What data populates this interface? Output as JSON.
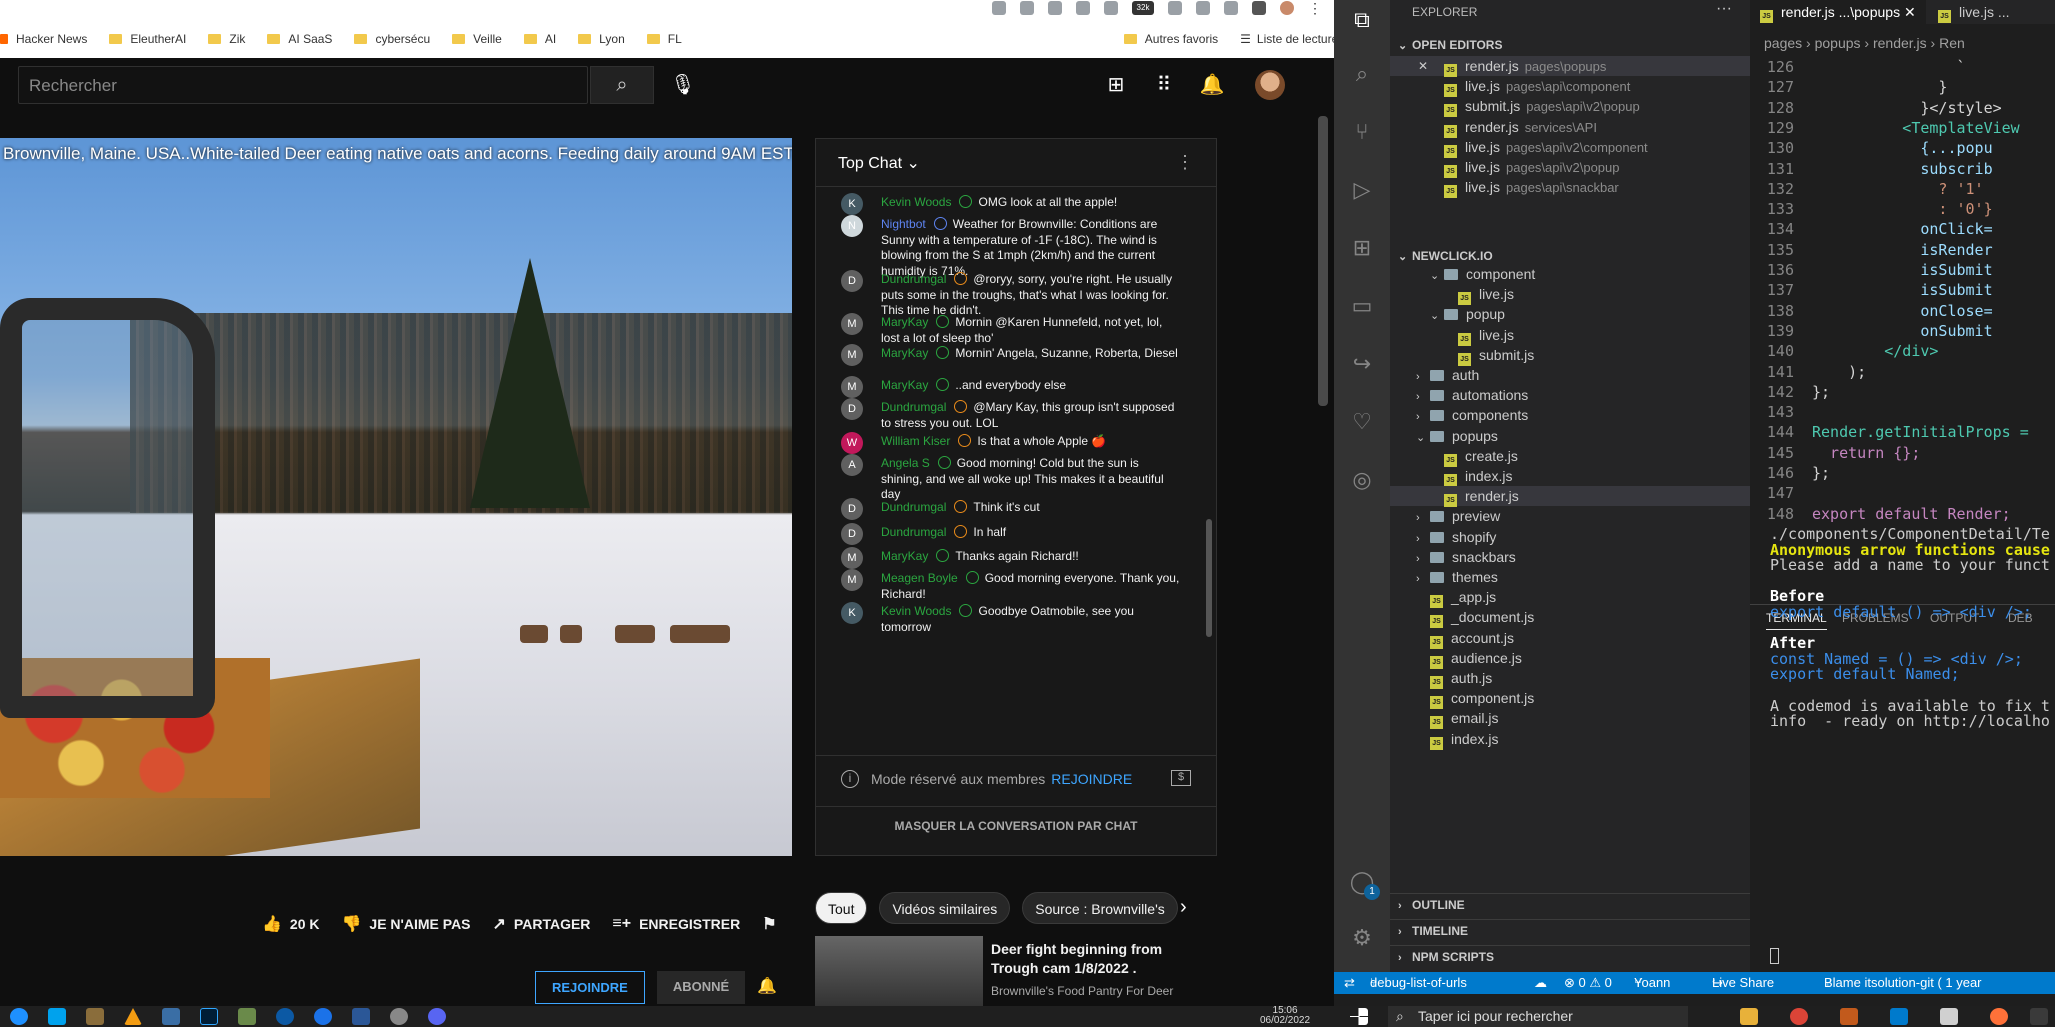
{
  "browser": {
    "bookmarks": [
      "Hacker News",
      "EleutherAI",
      "Zik",
      "AI SaaS",
      "cybersécu",
      "Veille",
      "AI",
      "Lyon",
      "FL"
    ],
    "bookmarks_right": [
      "Autres favoris",
      "Liste de lecture"
    ],
    "ext_badge": "32k"
  },
  "youtube": {
    "search_placeholder": "Rechercher",
    "video_title": "Brownville, Maine. USA..White-tailed Deer eating native oats and acorns. Feeding daily around 9AM EST",
    "chat": {
      "header": "Top Chat",
      "messages": [
        {
          "initial": "K",
          "author": "Kevin Woods",
          "badge": "verified",
          "text": "OMG look at all the apple!"
        },
        {
          "initial": "N",
          "author": "Nightbot",
          "badge": "mod",
          "text": "Weather for Brownville: Conditions are Sunny with a temperature of -1F (-18C). The wind is blowing from the S at 1mph (2km/h) and the current humidity is 71%."
        },
        {
          "initial": "D",
          "author": "Dundrumgal",
          "badge": "member",
          "text": "@roryy, sorry, you're right. He usually puts some in the troughs, that's what I was looking for. This time he didn't."
        },
        {
          "initial": "M",
          "author": "MaryKay",
          "badge": "verified",
          "text": "Mornin @Karen Hunnefeld, not yet, lol, lost a lot of sleep tho'"
        },
        {
          "initial": "M",
          "author": "MaryKay",
          "badge": "verified",
          "text": "Mornin' Angela, Suzanne, Roberta, Diesel"
        },
        {
          "initial": "M",
          "author": "MaryKay",
          "badge": "verified",
          "text": "..and everybody else"
        },
        {
          "initial": "D",
          "author": "Dundrumgal",
          "badge": "member",
          "text": "@Mary Kay, this group isn't supposed to stress you out. LOL"
        },
        {
          "initial": "W",
          "author": "William Kiser",
          "badge": "member",
          "text": "Is that a whole Apple 🍎"
        },
        {
          "initial": "A",
          "author": "Angela S",
          "badge": "verified",
          "text": "Good morning! Cold but the sun is shining, and we all woke up! This makes it a beautiful day"
        },
        {
          "initial": "D",
          "author": "Dundrumgal",
          "badge": "member",
          "text": "Think it's cut"
        },
        {
          "initial": "D",
          "author": "Dundrumgal",
          "badge": "member",
          "text": "In half"
        },
        {
          "initial": "M",
          "author": "MaryKay",
          "badge": "verified",
          "text": "Thanks again Richard!!"
        },
        {
          "initial": "M",
          "author": "Meagen Boyle",
          "badge": "verified",
          "text": "Good morning everyone. Thank you, Richard!"
        },
        {
          "initial": "K",
          "author": "Kevin Woods",
          "badge": "verified",
          "text": "Goodbye Oatmobile, see you tomorrow"
        }
      ],
      "members_only": "Mode réservé aux membres",
      "join_link": "REJOINDRE",
      "hide_chat": "MASQUER LA CONVERSATION PAR CHAT"
    },
    "actions": {
      "likes": "20 K",
      "dislike": "JE N'AIME PAS",
      "share": "PARTAGER",
      "save": "ENREGISTRER"
    },
    "join_button": "REJOINDRE",
    "subscribed_button": "ABONNÉ",
    "chips": [
      "Tout",
      "Vidéos similaires",
      "Source : Brownville's"
    ],
    "related": {
      "title": "Deer fight beginning from Trough cam 1/8/2022 .",
      "channel": "Brownville's Food Pantry For Deer"
    }
  },
  "vscode": {
    "explorer_title": "EXPLORER",
    "open_editors_title": "OPEN EDITORS",
    "open_editors": [
      {
        "name": "render.js",
        "path": "pages\\popups",
        "active": true
      },
      {
        "name": "live.js",
        "path": "pages\\api\\component"
      },
      {
        "name": "submit.js",
        "path": "pages\\api\\v2\\popup"
      },
      {
        "name": "render.js",
        "path": "services\\API"
      },
      {
        "name": "live.js",
        "path": "pages\\api\\v2\\component"
      },
      {
        "name": "live.js",
        "path": "pages\\api\\v2\\popup"
      },
      {
        "name": "live.js",
        "path": "pages\\api\\snackbar"
      }
    ],
    "project_title": "NEWCLICK.IO",
    "tree": [
      {
        "name": "component",
        "type": "dir-open",
        "indent": 2
      },
      {
        "name": "live.js",
        "type": "file",
        "indent": 3
      },
      {
        "name": "popup",
        "type": "dir-open",
        "indent": 2
      },
      {
        "name": "live.js",
        "type": "file",
        "indent": 3
      },
      {
        "name": "submit.js",
        "type": "file",
        "indent": 3
      },
      {
        "name": "auth",
        "type": "dir",
        "indent": 1
      },
      {
        "name": "automations",
        "type": "dir",
        "indent": 1
      },
      {
        "name": "components",
        "type": "dir",
        "indent": 1
      },
      {
        "name": "popups",
        "type": "dir-open",
        "indent": 1
      },
      {
        "name": "create.js",
        "type": "file",
        "indent": 2
      },
      {
        "name": "index.js",
        "type": "file",
        "indent": 2
      },
      {
        "name": "render.js",
        "type": "file",
        "indent": 2,
        "selected": true
      },
      {
        "name": "preview",
        "type": "dir",
        "indent": 1
      },
      {
        "name": "shopify",
        "type": "dir",
        "indent": 1
      },
      {
        "name": "snackbars",
        "type": "dir",
        "indent": 1
      },
      {
        "name": "themes",
        "type": "dir",
        "indent": 1
      },
      {
        "name": "_app.js",
        "type": "file",
        "indent": 1
      },
      {
        "name": "_document.js",
        "type": "file",
        "indent": 1
      },
      {
        "name": "account.js",
        "type": "file",
        "indent": 1
      },
      {
        "name": "audience.js",
        "type": "file",
        "indent": 1
      },
      {
        "name": "auth.js",
        "type": "file",
        "indent": 1
      },
      {
        "name": "component.js",
        "type": "file",
        "indent": 1
      },
      {
        "name": "email.js",
        "type": "file",
        "indent": 1
      },
      {
        "name": "index.js",
        "type": "file",
        "indent": 1
      }
    ],
    "outline": "OUTLINE",
    "timeline": "TIMELINE",
    "npm_scripts": "NPM SCRIPTS",
    "tabs": [
      {
        "label": "render.js ...\\popups",
        "active": true
      },
      {
        "label": "live.js ...",
        "active": false
      }
    ],
    "breadcrumb": "pages › popups › render.js › Ren",
    "code": [
      {
        "n": "126",
        "t": "                `"
      },
      {
        "n": "127",
        "t": "              }"
      },
      {
        "n": "128",
        "t": "            }</style>"
      },
      {
        "n": "129",
        "t": "          <TemplateView"
      },
      {
        "n": "130",
        "t": "            {...popu"
      },
      {
        "n": "131",
        "t": "            subscrib"
      },
      {
        "n": "132",
        "t": "              ? '1'"
      },
      {
        "n": "133",
        "t": "              : '0'}"
      },
      {
        "n": "134",
        "t": "            onClick="
      },
      {
        "n": "135",
        "t": "            isRender"
      },
      {
        "n": "136",
        "t": "            isSubmit"
      },
      {
        "n": "137",
        "t": "            isSubmit"
      },
      {
        "n": "138",
        "t": "            onClose="
      },
      {
        "n": "139",
        "t": "            onSubmit"
      },
      {
        "n": "140",
        "t": "        </div>"
      },
      {
        "n": "141",
        "t": "    );"
      },
      {
        "n": "142",
        "t": "};"
      },
      {
        "n": "143",
        "t": ""
      },
      {
        "n": "144",
        "t": "Render.getInitialProps ="
      },
      {
        "n": "145",
        "t": "  return {};"
      },
      {
        "n": "146",
        "t": "};"
      },
      {
        "n": "147",
        "t": ""
      },
      {
        "n": "148",
        "t": "export default Render;"
      }
    ],
    "panel_tabs": [
      "TERMINAL",
      "PROBLEMS",
      "OUTPUT",
      "DEB"
    ],
    "terminal": [
      {
        "t": "./components/ComponentDetail/Te",
        "c": "#cccccc",
        "b": false
      },
      {
        "t": "Anonymous arrow functions cause",
        "c": "#e5e510",
        "b": true
      },
      {
        "t": "Please add a name to your funct",
        "c": "#cccccc",
        "b": false
      },
      {
        "t": "",
        "c": "#cccccc",
        "b": false
      },
      {
        "t": "Before",
        "c": "#ffffff",
        "b": true
      },
      {
        "t": "export default () => <div />;",
        "c": "#3b8eea",
        "b": false
      },
      {
        "t": "",
        "c": "#cccccc",
        "b": false
      },
      {
        "t": "After",
        "c": "#ffffff",
        "b": true
      },
      {
        "t": "const Named = () => <div />;",
        "c": "#3b8eea",
        "b": false
      },
      {
        "t": "export default Named;",
        "c": "#3b8eea",
        "b": false
      },
      {
        "t": "",
        "c": "#cccccc",
        "b": false
      },
      {
        "t": "A codemod is available to fix t",
        "c": "#cccccc",
        "b": false
      },
      {
        "t": "info  - ready on http://localho",
        "c": "#cccccc",
        "b": false
      }
    ],
    "status": {
      "branch": "debug-list-of-urls",
      "problems": "⊗ 0 ⚠ 0",
      "user": "Yoann",
      "live_share": "Live Share",
      "blame": "Blame itsolution-git ( 1 year"
    }
  },
  "taskbar": {
    "search_placeholder": "Taper ici pour rechercher",
    "time": "15:06",
    "date": "06/02/2022"
  },
  "colors": {
    "yt_bg": "#0f0f0f",
    "vscode_accent": "#007acc",
    "member_badge": "#e98b1a",
    "verified": "#2ba640"
  }
}
